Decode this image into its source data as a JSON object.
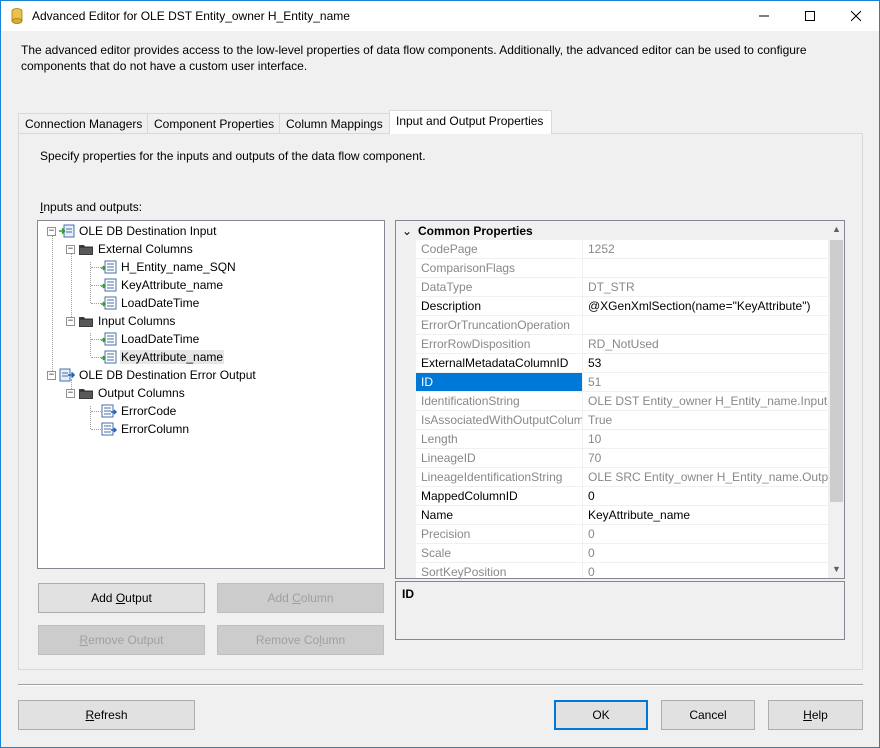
{
  "window": {
    "title": "Advanced Editor for OLE DST Entity_owner H_Entity_name"
  },
  "description": "The advanced editor provides access to the low-level properties of data flow components. Additionally, the advanced editor can be used to configure components that do not have a custom user interface.",
  "tabs": [
    {
      "label": "Connection Managers",
      "active": false
    },
    {
      "label": "Component Properties",
      "active": false
    },
    {
      "label": "Column Mappings",
      "active": false
    },
    {
      "label": "Input and Output Properties",
      "active": true
    }
  ],
  "tab_description": "Specify properties for the inputs and outputs of the data flow component.",
  "inputs_outputs_label": "Inputs and outputs:",
  "tree": [
    {
      "label": "OLE DB Destination Input",
      "icon": "input-icon"
    },
    {
      "label": "External Columns",
      "icon": "folder-icon"
    },
    {
      "label": "H_Entity_name_SQN",
      "icon": "column-icon"
    },
    {
      "label": "KeyAttribute_name",
      "icon": "column-icon"
    },
    {
      "label": "LoadDateTime",
      "icon": "column-icon"
    },
    {
      "label": "Input Columns",
      "icon": "folder-icon"
    },
    {
      "label": "LoadDateTime",
      "icon": "column-icon"
    },
    {
      "label": "KeyAttribute_name",
      "icon": "column-icon",
      "selected": true
    },
    {
      "label": "OLE DB Destination Error Output",
      "icon": "output-icon"
    },
    {
      "label": "Output Columns",
      "icon": "folder-icon"
    },
    {
      "label": "ErrorCode",
      "icon": "column-icon"
    },
    {
      "label": "ErrorColumn",
      "icon": "column-icon"
    }
  ],
  "buttons": {
    "add_output": "Add Output",
    "add_column": "Add Column",
    "remove_output": "Remove Output",
    "remove_column": "Remove Column",
    "refresh": "Refresh",
    "ok": "OK",
    "cancel": "Cancel",
    "help": "Help"
  },
  "property_grid": {
    "category": "Common Properties",
    "rows": [
      {
        "name": "CodePage",
        "value": "1252",
        "editable": false
      },
      {
        "name": "ComparisonFlags",
        "value": "",
        "editable": false
      },
      {
        "name": "DataType",
        "value": "DT_STR",
        "editable": false
      },
      {
        "name": "Description",
        "value": "@XGenXmlSection(name=\"KeyAttribute\")",
        "editable": true
      },
      {
        "name": "ErrorOrTruncationOperation",
        "value": "",
        "editable": false
      },
      {
        "name": "ErrorRowDisposition",
        "value": "RD_NotUsed",
        "editable": false
      },
      {
        "name": "ExternalMetadataColumnID",
        "value": "53",
        "editable": true
      },
      {
        "name": "ID",
        "value": "51",
        "editable": false,
        "selected": true
      },
      {
        "name": "IdentificationString",
        "value": "OLE DST Entity_owner H_Entity_name.Inputs[O",
        "editable": false
      },
      {
        "name": "IsAssociatedWithOutputColumn",
        "value": "True",
        "editable": false
      },
      {
        "name": "Length",
        "value": "10",
        "editable": false
      },
      {
        "name": "LineageID",
        "value": "70",
        "editable": false
      },
      {
        "name": "LineageIdentificationString",
        "value": "OLE SRC Entity_owner H_Entity_name.Output",
        "editable": false
      },
      {
        "name": "MappedColumnID",
        "value": "0",
        "editable": true
      },
      {
        "name": "Name",
        "value": "KeyAttribute_name",
        "editable": true
      },
      {
        "name": "Precision",
        "value": "0",
        "editable": false
      },
      {
        "name": "Scale",
        "value": "0",
        "editable": false
      },
      {
        "name": "SortKeyPosition",
        "value": "0",
        "editable": false
      }
    ],
    "description_title": "ID"
  },
  "colors": {
    "accent": "#0078d7",
    "window_border": "#1883d7",
    "background": "#f0f0f0"
  }
}
